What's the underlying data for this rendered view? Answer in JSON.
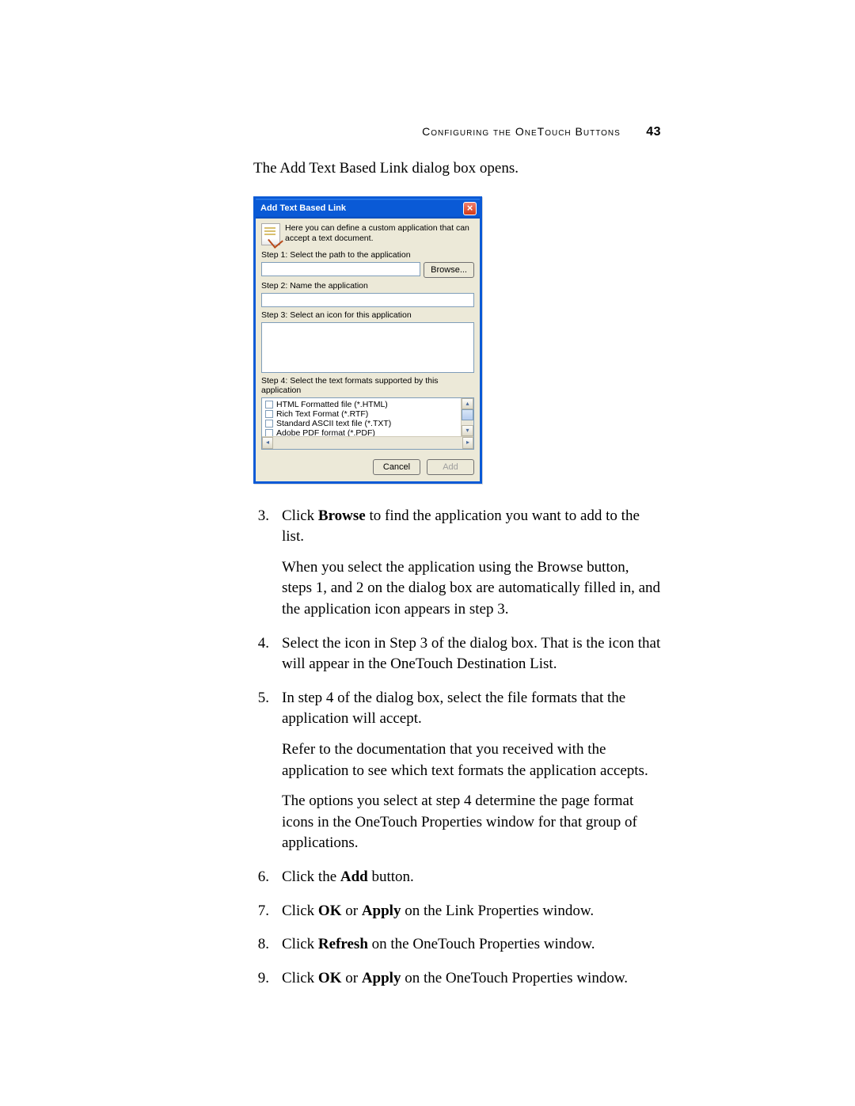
{
  "header": {
    "section": "Configuring the OneTouch Buttons",
    "page_number": "43"
  },
  "intro": "The Add Text Based Link dialog box opens.",
  "dialog": {
    "title": "Add Text Based Link",
    "close": "×",
    "info": "Here you can define a custom application that can accept a text document.",
    "step1_label": "Step 1: Select the path to the application",
    "browse": "Browse...",
    "step2_label": "Step 2: Name the application",
    "step3_label": "Step 3: Select an icon for this application",
    "step4_label": "Step 4: Select the text formats supported by this application",
    "formats": [
      "HTML Formatted file (*.HTML)",
      "Rich Text Format (*.RTF)",
      "Standard ASCII text file (*.TXT)",
      "Adobe PDF format (*.PDF)"
    ],
    "scroll_up": "▴",
    "scroll_down": "▾",
    "scroll_left": "◂",
    "scroll_right": "▸",
    "cancel": "Cancel",
    "add": "Add"
  },
  "body": {
    "s3_a": "Click ",
    "s3_b": "Browse",
    "s3_c": " to find the application you want to add to the list.",
    "s3_p2": "When you select the application using the Browse button, steps 1, and 2 on the dialog box are automatically filled in, and the application icon appears in step 3.",
    "s4": "Select the icon in Step 3 of the dialog box. That is the icon that will appear in the OneTouch Destination List.",
    "s5_p1": "In step 4 of the dialog box, select the file formats that the application will accept.",
    "s5_p2": "Refer to the documentation that you received with the application to see which text formats the application accepts.",
    "s5_p3": "The options you select at step 4 determine the page format icons in the OneTouch Properties window for that group of applications.",
    "s6_a": "Click the ",
    "s6_b": "Add",
    "s6_c": " button.",
    "s7_a": "Click ",
    "s7_b": "OK",
    "s7_c": " or ",
    "s7_d": "Apply",
    "s7_e": " on the Link Properties window.",
    "s8_a": "Click ",
    "s8_b": "Refresh",
    "s8_c": " on the OneTouch Properties window.",
    "s9_a": "Click ",
    "s9_b": "OK",
    "s9_c": " or ",
    "s9_d": "Apply",
    "s9_e": " on the OneTouch Properties window.",
    "n3": "3.",
    "n4": "4.",
    "n5": "5.",
    "n6": "6.",
    "n7": "7.",
    "n8": "8.",
    "n9": "9."
  }
}
